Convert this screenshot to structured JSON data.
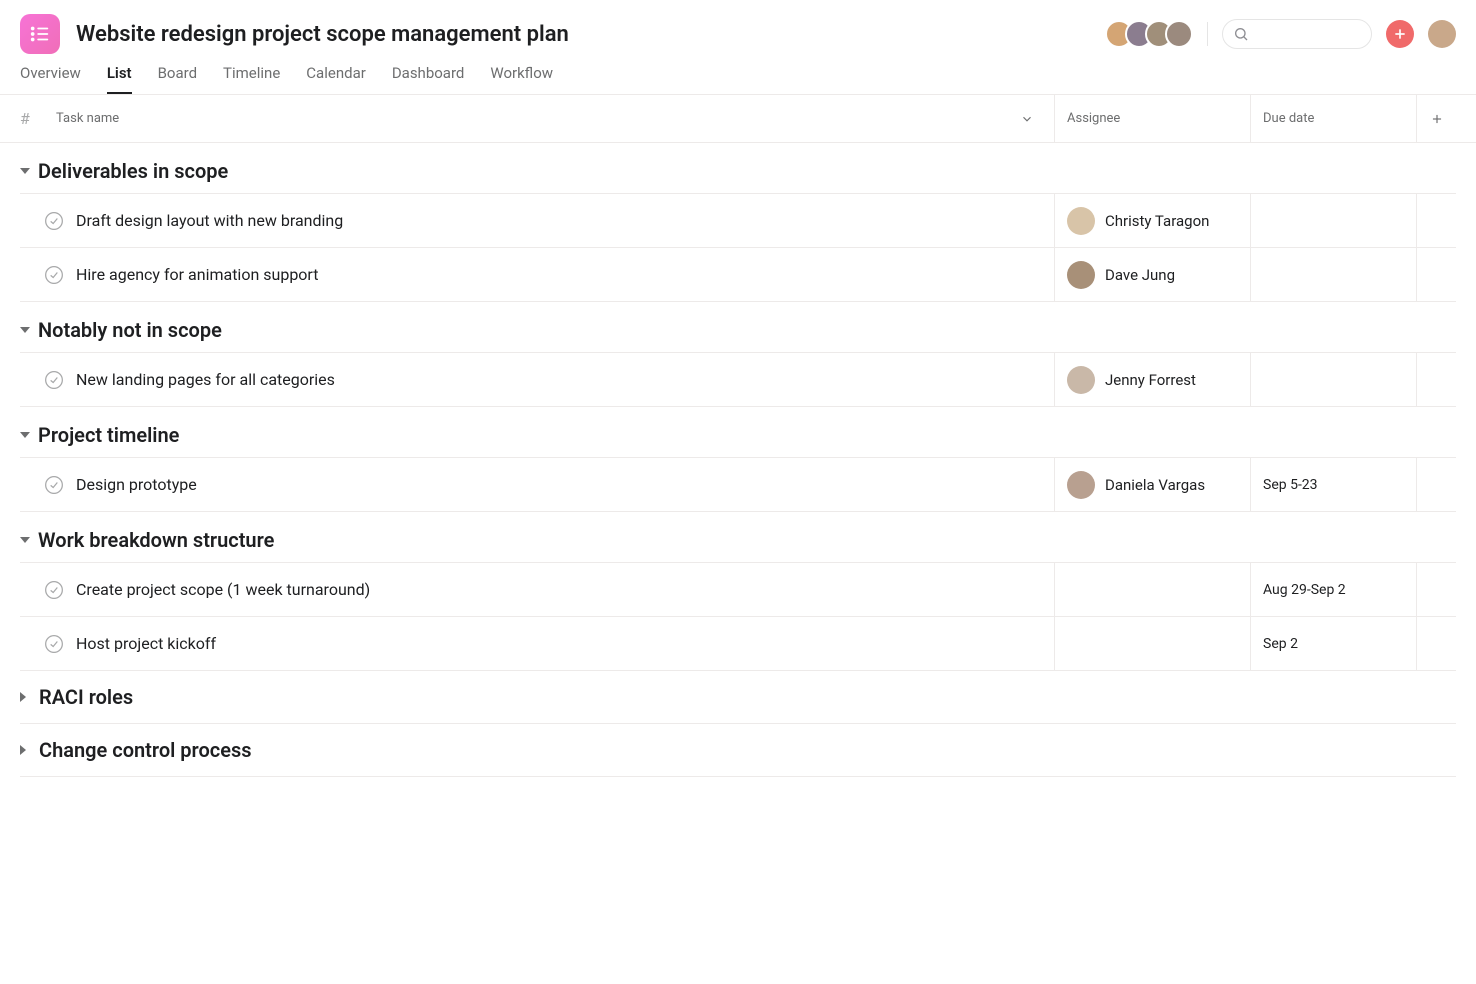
{
  "project": {
    "title": "Website redesign project scope management plan"
  },
  "tabs": [
    {
      "label": "Overview",
      "active": false
    },
    {
      "label": "List",
      "active": true
    },
    {
      "label": "Board",
      "active": false
    },
    {
      "label": "Timeline",
      "active": false
    },
    {
      "label": "Calendar",
      "active": false
    },
    {
      "label": "Dashboard",
      "active": false
    },
    {
      "label": "Workflow",
      "active": false
    }
  ],
  "columns": {
    "num": "#",
    "task_name": "Task name",
    "assignee": "Assignee",
    "due_date": "Due date"
  },
  "sections": [
    {
      "title": "Deliverables in scope",
      "collapsed": false,
      "tasks": [
        {
          "name": "Draft design layout with new branding",
          "assignee": "Christy Taragon",
          "due": ""
        },
        {
          "name": "Hire agency for animation support",
          "assignee": "Dave Jung",
          "due": ""
        }
      ]
    },
    {
      "title": "Notably not in scope",
      "collapsed": false,
      "tasks": [
        {
          "name": "New landing pages for all categories",
          "assignee": "Jenny Forrest",
          "due": ""
        }
      ]
    },
    {
      "title": "Project timeline",
      "collapsed": false,
      "tasks": [
        {
          "name": "Design prototype",
          "assignee": "Daniela Vargas",
          "due": "Sep 5-23"
        }
      ]
    },
    {
      "title": "Work breakdown structure",
      "collapsed": false,
      "tasks": [
        {
          "name": "Create project scope (1 week turnaround)",
          "assignee": "",
          "due": "Aug 29-Sep 2"
        },
        {
          "name": "Host project kickoff",
          "assignee": "",
          "due": "Sep 2"
        }
      ]
    },
    {
      "title": "RACI roles",
      "collapsed": true,
      "tasks": []
    },
    {
      "title": "Change control process",
      "collapsed": true,
      "tasks": []
    }
  ]
}
